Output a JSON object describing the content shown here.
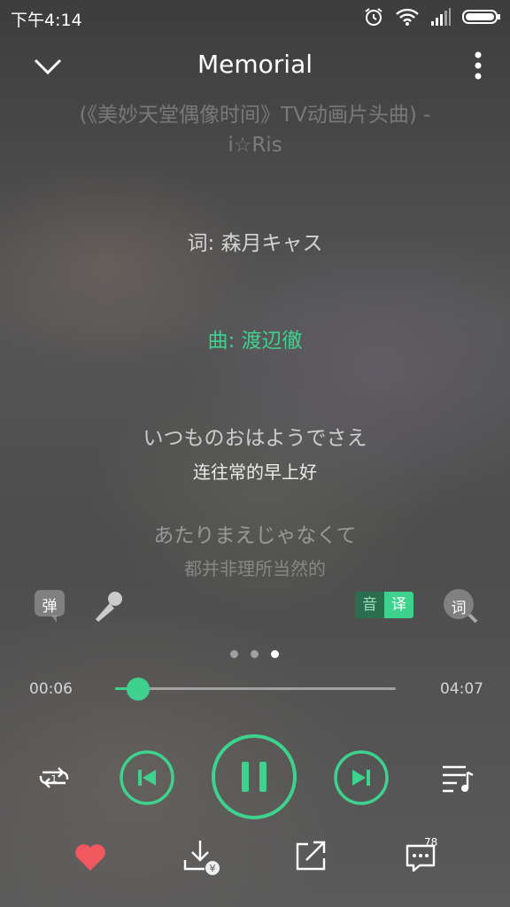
{
  "status_bar": {
    "time": "下午4:14"
  },
  "header": {
    "title": "Memorial"
  },
  "subtitle": {
    "line1": "(《美妙天堂偶像时间》TV动画片头曲) -",
    "line2": "i☆Ris"
  },
  "lyrics": {
    "lyricist": "词: 森月キャス",
    "composer": "曲: 渡辺徹",
    "line1_jp": "いつものおはようでさえ",
    "line1_cn": "连往常的早上好",
    "line2_jp": "あたりまえじゃなくて",
    "line2_cn": "都并非理所当然的"
  },
  "tools": {
    "danmaku_label": "弹",
    "translate_off": "音",
    "translate_on": "译",
    "lyric_search_label": "词"
  },
  "pager": {
    "pages": 3,
    "active_index": 2
  },
  "progress": {
    "current": "00:06",
    "total": "04:07",
    "fraction": 0.06
  },
  "comments": {
    "count": "78"
  },
  "colors": {
    "accent": "#3ed28e",
    "heart": "#f0575f"
  }
}
